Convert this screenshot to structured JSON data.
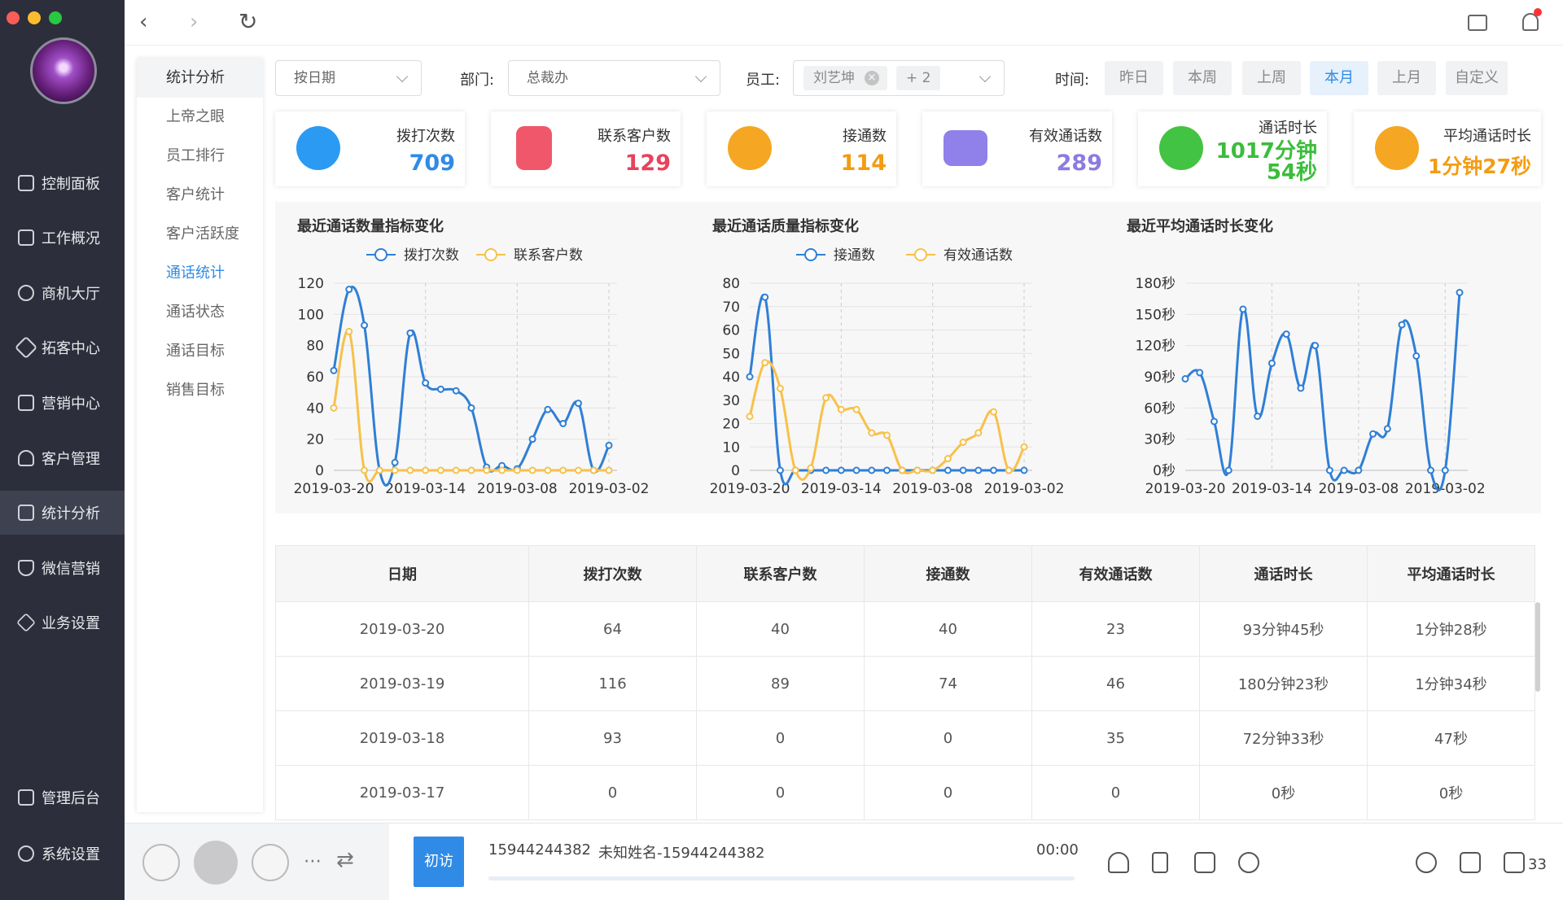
{
  "nav": {
    "items": [
      {
        "label": "控制面板",
        "icon": "dashboard-icon"
      },
      {
        "label": "工作概况",
        "icon": "monitor-icon"
      },
      {
        "label": "商机大厅",
        "icon": "money-icon"
      },
      {
        "label": "拓客中心",
        "icon": "target-icon"
      },
      {
        "label": "营销中心",
        "icon": "chart-line-icon"
      },
      {
        "label": "客户管理",
        "icon": "user-icon"
      },
      {
        "label": "统计分析",
        "icon": "bar-chart-icon"
      },
      {
        "label": "微信营销",
        "icon": "shield-icon"
      },
      {
        "label": "业务设置",
        "icon": "layers-icon"
      },
      {
        "label": "管理后台",
        "icon": "grid-icon"
      },
      {
        "label": "系统设置",
        "icon": "gear-icon"
      }
    ],
    "active_index": 6
  },
  "submenu": {
    "header": "统计分析",
    "items": [
      "上帝之眼",
      "员工排行",
      "客户统计",
      "客户活跃度",
      "通话统计",
      "通话状态",
      "通话目标",
      "销售目标"
    ],
    "active_index": 4
  },
  "filters": {
    "period": "按日期",
    "dept_label": "部门:",
    "dept_value": "总裁办",
    "staff_label": "员工:",
    "staff_tag": "刘艺坤",
    "staff_more": "+ 2",
    "time_label": "时间:",
    "time_buttons": [
      "昨日",
      "本周",
      "上周",
      "本月",
      "上月",
      "自定义"
    ],
    "time_active": 3
  },
  "stats": [
    {
      "label": "拨打次数",
      "value": "709",
      "color": "#2f8be6",
      "icon_color": "#2b9af3"
    },
    {
      "label": "联系客户数",
      "value": "129",
      "color": "#e8425c",
      "icon_color": "#f0576b"
    },
    {
      "label": "接通数",
      "value": "114",
      "color": "#f39c12",
      "icon_color": "#f5a623"
    },
    {
      "label": "有效通话数",
      "value": "289",
      "color": "#8a7ce0",
      "icon_color": "#8f80ea"
    },
    {
      "label": "通话时长",
      "value": "1017分钟54秒",
      "value_line1": "1017分钟",
      "value_line2": "54秒",
      "color": "#3bbd3b",
      "icon_color": "#43c343"
    },
    {
      "label": "平均通话时长",
      "value": "1分钟27秒",
      "color": "#f39c12",
      "icon_color": "#f5a623"
    }
  ],
  "chart_data": [
    {
      "type": "line",
      "title": "最近通话数量指标变化",
      "x": [
        "2019-03-20",
        "2019-03-19",
        "2019-03-18",
        "2019-03-17",
        "2019-03-16",
        "2019-03-15",
        "2019-03-14",
        "2019-03-13",
        "2019-03-12",
        "2019-03-11",
        "2019-03-10",
        "2019-03-09",
        "2019-03-08",
        "2019-03-07",
        "2019-03-06",
        "2019-03-05",
        "2019-03-04",
        "2019-03-03",
        "2019-03-02"
      ],
      "x_ticks": [
        "2019-03-20",
        "2019-03-14",
        "2019-03-08",
        "2019-03-02"
      ],
      "ylim": [
        0,
        120
      ],
      "y_ticks": [
        "0",
        "20",
        "40",
        "60",
        "80",
        "100",
        "120"
      ],
      "series": [
        {
          "name": "拨打次数",
          "color": "#2f7fd6",
          "values": [
            64,
            116,
            93,
            0,
            5,
            88,
            56,
            52,
            51,
            40,
            2,
            3,
            1,
            20,
            39,
            30,
            43,
            0,
            16
          ]
        },
        {
          "name": "联系客户数",
          "color": "#f7c14a",
          "values": [
            40,
            89,
            0,
            0,
            0,
            0,
            0,
            0,
            0,
            0,
            0,
            0,
            0,
            0,
            0,
            0,
            0,
            0,
            0
          ]
        }
      ],
      "legend": "top-center",
      "grid": "dashed-vertical"
    },
    {
      "type": "line",
      "title": "最近通话质量指标变化",
      "x": [
        "2019-03-20",
        "2019-03-19",
        "2019-03-18",
        "2019-03-17",
        "2019-03-16",
        "2019-03-15",
        "2019-03-14",
        "2019-03-13",
        "2019-03-12",
        "2019-03-11",
        "2019-03-10",
        "2019-03-09",
        "2019-03-08",
        "2019-03-07",
        "2019-03-06",
        "2019-03-05",
        "2019-03-04",
        "2019-03-03",
        "2019-03-02"
      ],
      "x_ticks": [
        "2019-03-20",
        "2019-03-14",
        "2019-03-08",
        "2019-03-02"
      ],
      "ylim": [
        0,
        80
      ],
      "y_ticks": [
        "0",
        "10",
        "20",
        "30",
        "40",
        "50",
        "60",
        "70",
        "80"
      ],
      "series": [
        {
          "name": "接通数",
          "color": "#2f7fd6",
          "values": [
            40,
            74,
            0,
            0,
            0,
            0,
            0,
            0,
            0,
            0,
            0,
            0,
            0,
            0,
            0,
            0,
            0,
            0,
            0
          ]
        },
        {
          "name": "有效通话数",
          "color": "#f7c14a",
          "values": [
            23,
            46,
            35,
            0,
            1,
            31,
            26,
            26,
            16,
            15,
            0,
            0,
            0,
            5,
            12,
            16,
            25,
            0,
            10
          ]
        }
      ],
      "legend": "top-center",
      "grid": "dashed-vertical"
    },
    {
      "type": "line",
      "title": "最近平均通话时长变化",
      "x": [
        "2019-03-20",
        "2019-03-19",
        "2019-03-18",
        "2019-03-17",
        "2019-03-16",
        "2019-03-15",
        "2019-03-14",
        "2019-03-13",
        "2019-03-12",
        "2019-03-11",
        "2019-03-10",
        "2019-03-09",
        "2019-03-08",
        "2019-03-07",
        "2019-03-06",
        "2019-03-05",
        "2019-03-04",
        "2019-03-03",
        "2019-03-02"
      ],
      "x_ticks": [
        "2019-03-20",
        "2019-03-14",
        "2019-03-08",
        "2019-03-02"
      ],
      "ylim": [
        0,
        180
      ],
      "y_ticks": [
        "0秒",
        "30秒",
        "60秒",
        "90秒",
        "120秒",
        "150秒",
        "180秒"
      ],
      "series": [
        {
          "color": "#2f7fd6",
          "values": [
            88,
            94,
            47,
            0,
            155,
            52,
            103,
            131,
            79,
            120,
            0,
            0,
            0,
            35,
            40,
            140,
            110,
            0,
            0
          ]
        }
      ],
      "extra_point": 171,
      "grid": "dashed-vertical"
    }
  ],
  "table": {
    "columns": [
      "日期",
      "拨打次数",
      "联系客户数",
      "接通数",
      "有效通话数",
      "通话时长",
      "平均通话时长"
    ],
    "rows": [
      [
        "2019-03-20",
        "64",
        "40",
        "40",
        "23",
        "93分钟45秒",
        "1分钟28秒"
      ],
      [
        "2019-03-19",
        "116",
        "89",
        "74",
        "46",
        "180分钟23秒",
        "1分钟34秒"
      ],
      [
        "2019-03-18",
        "93",
        "0",
        "0",
        "35",
        "72分钟33秒",
        "47秒"
      ],
      [
        "2019-03-17",
        "0",
        "0",
        "0",
        "0",
        "0秒",
        "0秒"
      ]
    ]
  },
  "call": {
    "visit_label": "初访",
    "number": "15944244382",
    "name": "未知姓名-15944244382",
    "timer": "00:00",
    "count": "33"
  }
}
